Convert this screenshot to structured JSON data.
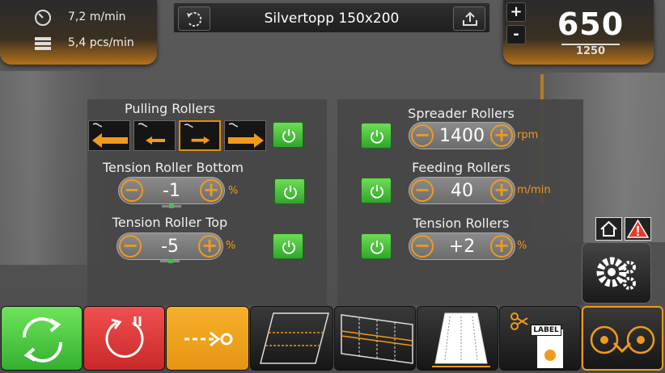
{
  "header": {
    "line_speed": "7,2 m/min",
    "piece_rate": "5,4 pcs/min",
    "recipe_title": "Silvertopp 150x200",
    "counter_value": "650",
    "counter_target": "1250",
    "plus_label": "+",
    "minus_label": "-"
  },
  "left_panel": {
    "pulling_rollers": {
      "label": "Pulling Rollers"
    },
    "tension_roller_bottom": {
      "label": "Tension Roller Bottom",
      "value": "-1",
      "unit": "%"
    },
    "tension_roller_top": {
      "label": "Tension Roller Top",
      "value": "-5",
      "unit": "%"
    }
  },
  "right_panel": {
    "spreader_rollers": {
      "label": "Spreader Rollers",
      "value": "1400",
      "unit": "rpm"
    },
    "feeding_rollers": {
      "label": "Feeding Rollers",
      "value": "40",
      "unit": "m/min"
    },
    "tension_rollers": {
      "label": "Tension Rollers",
      "value": "+2",
      "unit": "%"
    }
  },
  "toolbar": {
    "label_button_text": "LABEL"
  },
  "colors": {
    "accent_orange": "#f09a1d",
    "green": "#4cc23a",
    "red": "#e03a3a",
    "yellow_orange": "#f2a51a"
  }
}
